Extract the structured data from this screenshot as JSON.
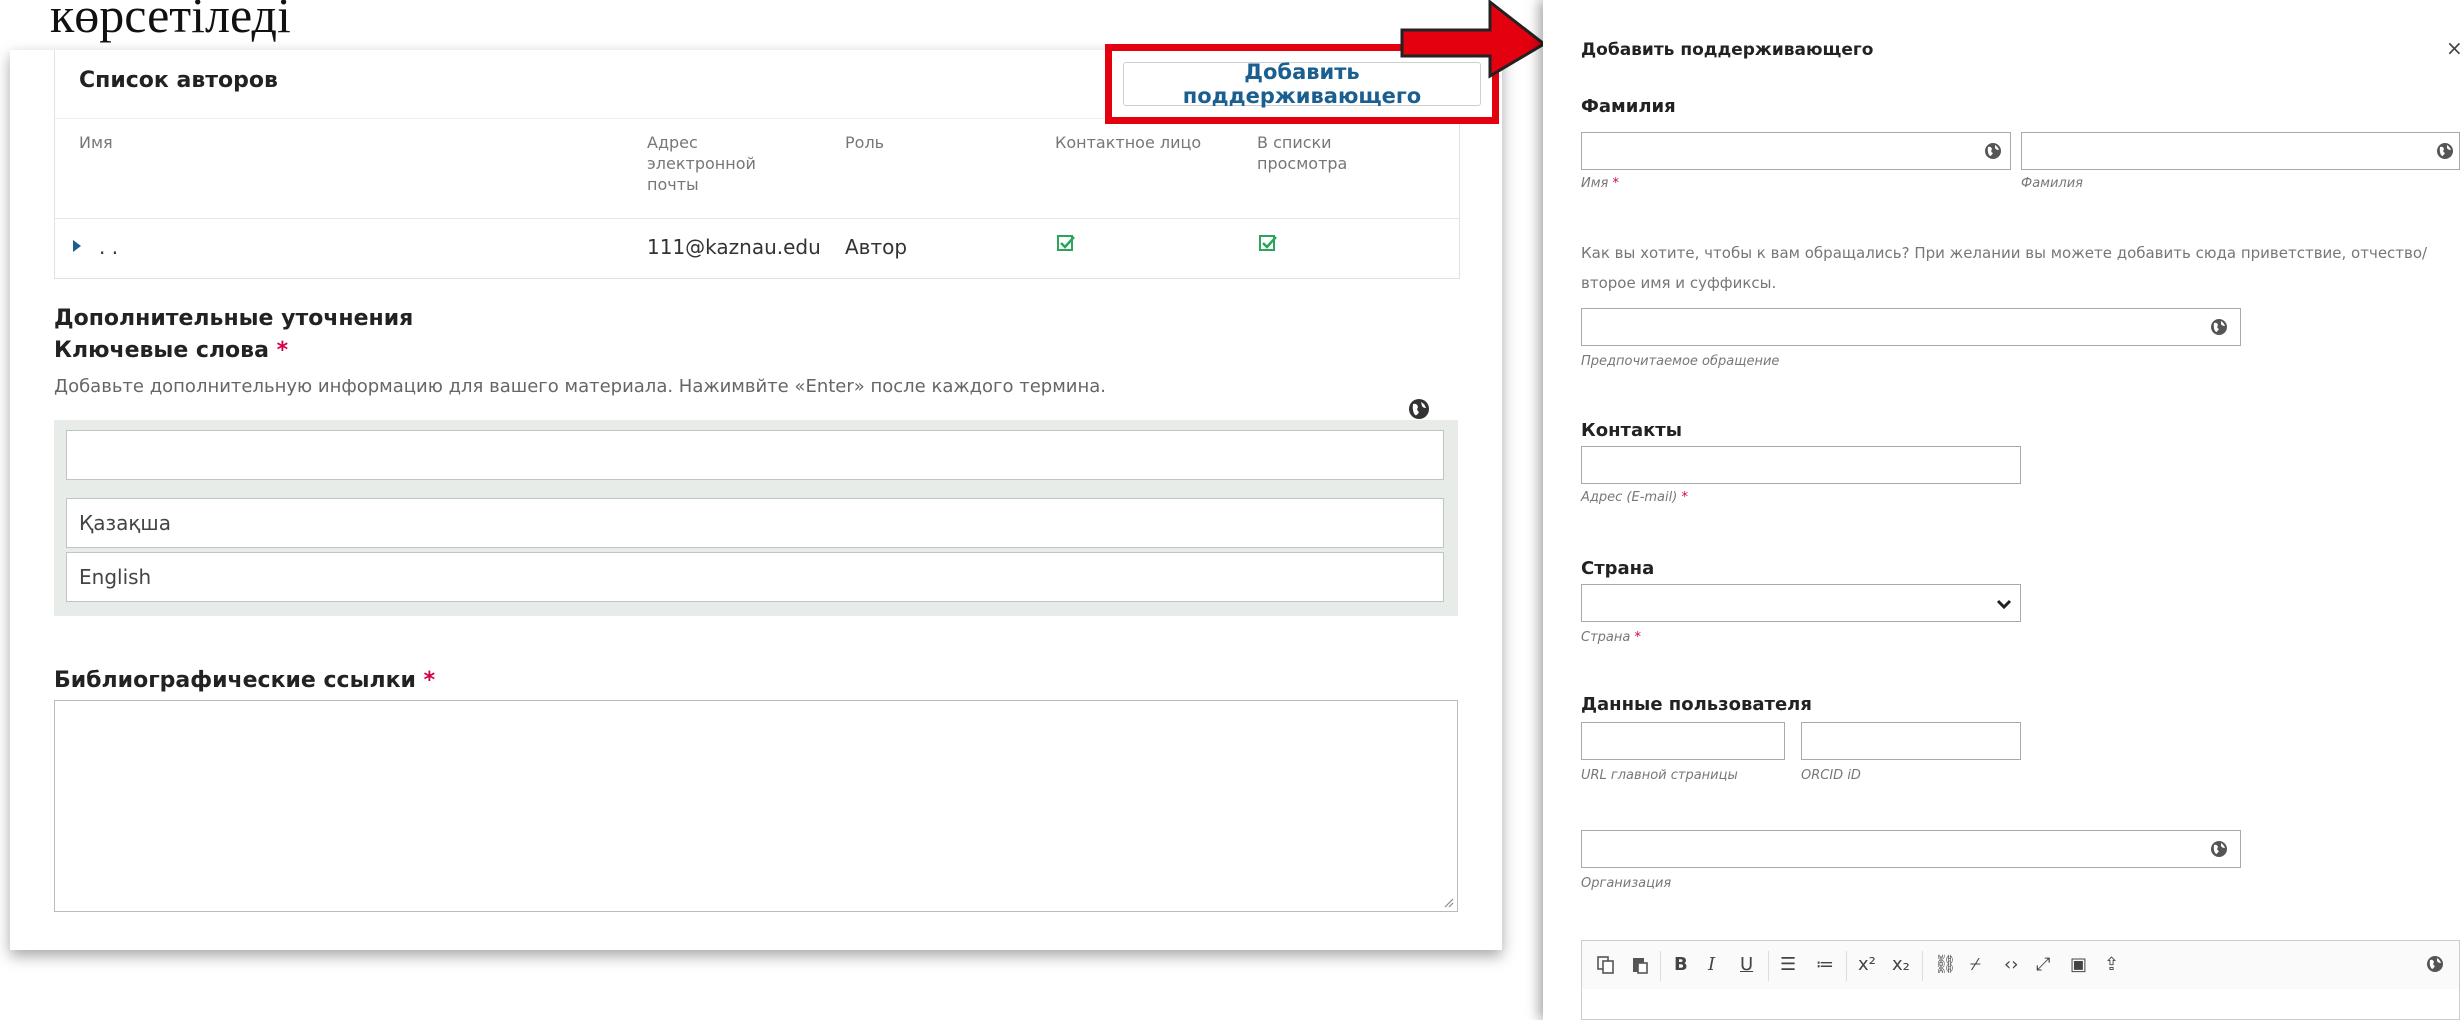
{
  "caption": "көрсетіледі",
  "authors": {
    "title": "Список авторов",
    "add_button": "Добавить поддерживающего",
    "columns": [
      "Имя",
      "Адрес электронной почты",
      "Роль",
      "Контактное лицо",
      "В списки просмотра"
    ],
    "rows": [
      {
        "name": ". .",
        "email": "111@kaznau.edu",
        "role": "Автор",
        "contact": true,
        "visible": true
      }
    ]
  },
  "extra": {
    "title": "Дополнительные уточнения",
    "keywords_label": "Ключевые слова",
    "required_mark": "*",
    "keywords_help": "Добавьте дополнительную информацию для вашего материала. Нажимвйте «Enter» после каждого термина.",
    "keyword_inputs": [
      "",
      "Қазақша",
      "English"
    ],
    "biblio_label": "Библиографические ссылки"
  },
  "dialog": {
    "title": "Добавить поддерживающего",
    "close": "×",
    "surname_label": "Фамилия",
    "first_name_hint": "Имя",
    "surname_hint": "Фамилия",
    "required_mark": "*",
    "salutation_help_1": "Как вы хотите, чтобы к вам обращались? При желании вы можете добавить сюда приветствие, отчество/",
    "salutation_help_2": "второе имя и суффиксы.",
    "preferred_hint": "Предпочитаемое обращение",
    "contacts_label": "Контакты",
    "email_hint": "Адрес (E-mail)",
    "country_label": "Страна",
    "country_value": "",
    "country_hint": "Страна",
    "user_data_label": "Данные пользователя",
    "url_hint": "URL главной страницы",
    "orcid_hint": "ORCID iD",
    "org_hint": "Организация",
    "toolbar_icons": [
      "copy-icon",
      "paste-icon",
      "bold-icon",
      "italic-icon",
      "underline-icon",
      "bullet-list-icon",
      "numbered-list-icon",
      "superscript-icon",
      "subscript-icon",
      "link-icon",
      "unlink-icon",
      "code-icon",
      "fullscreen-icon",
      "image-icon",
      "upload-icon",
      "globe-icon"
    ]
  },
  "colors": {
    "accent": "#1a5f8f",
    "highlight": "#e3000f",
    "required": "#d40044",
    "check": "#2aa55a"
  }
}
